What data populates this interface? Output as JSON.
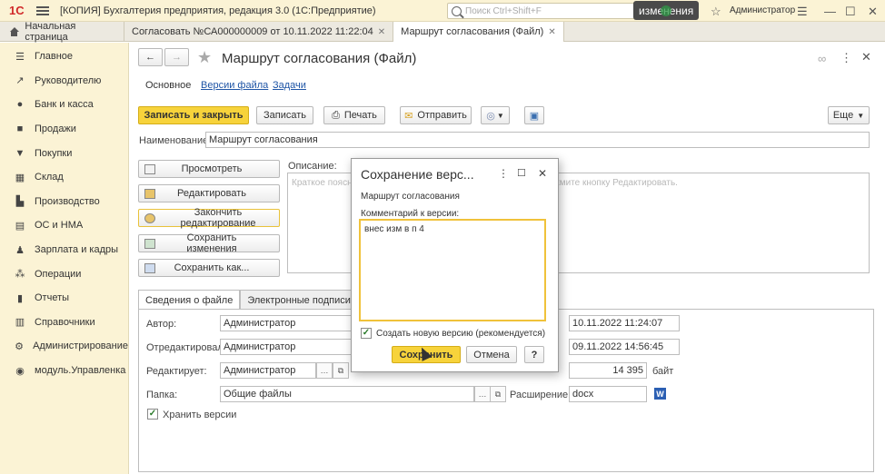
{
  "titlebar": {
    "logo": "1С",
    "title": "[КОПИЯ] Бухгалтерия предприятия, редакция 3.0  (1С:Предприятие)",
    "search_placeholder": "Поиск Ctrl+Shift+F",
    "changes_badge": "изменения",
    "user": "Администратор"
  },
  "tabs": [
    {
      "label": "Начальная страница"
    },
    {
      "label": "Согласовать №СА000000009 от 10.11.2022 11:22:04"
    },
    {
      "label": "Маршрут согласования (Файл)"
    }
  ],
  "sidebar": {
    "items": [
      {
        "label": "Главное",
        "icon": "menu-icon"
      },
      {
        "label": "Руководителю",
        "icon": "trend-icon"
      },
      {
        "label": "Банк и касса",
        "icon": "coin-icon"
      },
      {
        "label": "Продажи",
        "icon": "briefcase-icon"
      },
      {
        "label": "Покупки",
        "icon": "cart-icon"
      },
      {
        "label": "Склад",
        "icon": "warehouse-icon"
      },
      {
        "label": "Производство",
        "icon": "factory-icon"
      },
      {
        "label": "ОС и НМА",
        "icon": "building-icon"
      },
      {
        "label": "Зарплата и кадры",
        "icon": "person-icon"
      },
      {
        "label": "Операции",
        "icon": "operations-icon"
      },
      {
        "label": "Отчеты",
        "icon": "bar-chart-icon"
      },
      {
        "label": "Справочники",
        "icon": "books-icon"
      },
      {
        "label": "Администрирование",
        "icon": "gear-icon"
      },
      {
        "label": "модуль.Управленка",
        "icon": "module-icon"
      }
    ]
  },
  "form": {
    "title": "Маршрут согласования (Файл)",
    "subtabs": {
      "main": "Основное",
      "versions": "Версии файла",
      "tasks": "Задачи"
    },
    "toolbar": {
      "save_close": "Записать и закрыть",
      "save": "Записать",
      "print": "Печать",
      "send": "Отправить",
      "more": "Еще"
    },
    "name_label": "Наименование:",
    "name_value": "Маршрут согласования",
    "description_label": "Описание:",
    "description_placeholder_left": "Краткое поясн",
    "description_placeholder_right": "жмите кнопку Редактировать.",
    "side_buttons": {
      "view": "Просмотреть",
      "edit": "Редактировать",
      "finish_edit": "Закончить редактирование",
      "save_changes": "Сохранить изменения",
      "save_as": "Сохранить как..."
    },
    "lower_tabs": {
      "file_info": "Сведения о файле",
      "signatures": "Электронные подписи"
    },
    "fields": {
      "author_label": "Автор:",
      "author_value": "Администратор",
      "edited_label": "Отредактировал:",
      "edited_value": "Администратор",
      "editing_label": "Редактирует:",
      "editing_value": "Администратор",
      "folder_label": "Папка:",
      "folder_value": "Общие файлы",
      "keep_versions": "Хранить версии",
      "created_value": "10.11.2022 11:24:07",
      "modified_value": "09.11.2022 14:56:45",
      "size_value": "14 395",
      "size_unit": "байт",
      "extension_label": "Расширение:",
      "extension_value": "docx"
    }
  },
  "modal": {
    "title": "Сохранение верс...",
    "file_name": "Маршрут согласования",
    "comment_label": "Комментарий к версии:",
    "comment_value": "внес изм в п 4",
    "new_version_label": "Создать новую версию (рекомендуется)",
    "new_version_checked": true,
    "save_button": "Сохранить",
    "cancel_button": "Отмена",
    "help_button": "?"
  },
  "colors": {
    "accent": "#f7d33b",
    "sidebar_bg": "#fbf3d5",
    "link": "#1f55a6",
    "logo": "#d12a2a"
  }
}
